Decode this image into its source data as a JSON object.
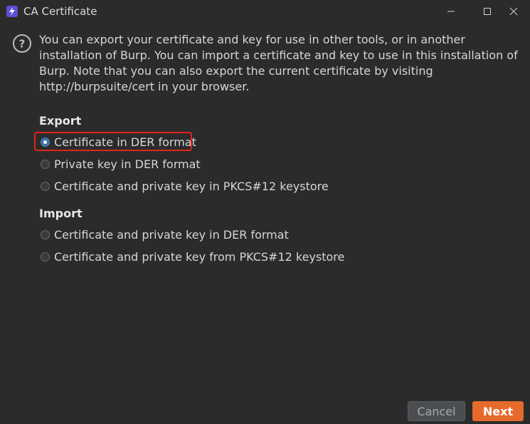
{
  "window": {
    "title": "CA Certificate",
    "controls": [
      "minimize-icon",
      "maximize-icon",
      "close-icon"
    ]
  },
  "description": "You can export your certificate and key for use in other tools, or in another installation of Burp. You can import a certificate and key to use in this installation of Burp. Note that you can also export the current certificate by visiting http://burpsuite/cert in your browser.",
  "export": {
    "title": "Export",
    "options": [
      {
        "label": "Certificate in DER format",
        "checked": true
      },
      {
        "label": "Private key in DER format",
        "checked": false
      },
      {
        "label": "Certificate and private key in PKCS#12 keystore",
        "checked": false
      }
    ]
  },
  "import": {
    "title": "Import",
    "options": [
      {
        "label": "Certificate and private key in DER format",
        "checked": false
      },
      {
        "label": "Certificate and private key from PKCS#12 keystore",
        "checked": false
      }
    ]
  },
  "buttons": {
    "cancel": "Cancel",
    "next": "Next"
  },
  "colors": {
    "background": "#2b2b2b",
    "accent": "#e56a2c",
    "highlight": "#e0241a",
    "radio_selected": "#4a88c7"
  }
}
